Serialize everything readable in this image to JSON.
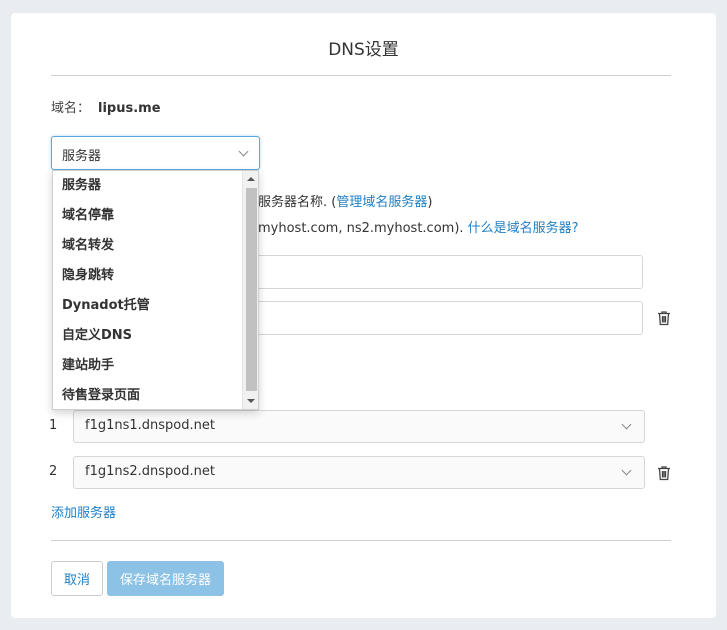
{
  "page": {
    "title": "DNS设置",
    "domain_label": "域名：",
    "domain_value": "lipus.me"
  },
  "type_select": {
    "selected": "服务器",
    "options": [
      "服务器",
      "域名停靠",
      "域名转发",
      "隐身跳转",
      "Dynadot托管",
      "自定义DNS",
      "建站助手",
      "待售登录页面"
    ]
  },
  "background_text": {
    "line1_prefix": "服务器名称. (",
    "line1_link": "管理域名服务器",
    "line1_suffix": ")",
    "line2_prefix": "myhost.com, ns2.myhost.com).",
    "line2_link": "什么是域名服务器?"
  },
  "nameservers": [
    {
      "index": "1",
      "value": "f1g1ns1.dnspod.net"
    },
    {
      "index": "2",
      "value": "f1g1ns2.dnspod.net"
    }
  ],
  "actions": {
    "add_server": "添加服务器",
    "cancel": "取消",
    "save": "保存域名服务器"
  },
  "colors": {
    "link": "#1f7fc4",
    "save_button": "#8cc2e6",
    "focus_border": "#5aa8e0"
  },
  "icons": {
    "trash": "trash-icon",
    "chevron": "chevron-down-icon"
  }
}
